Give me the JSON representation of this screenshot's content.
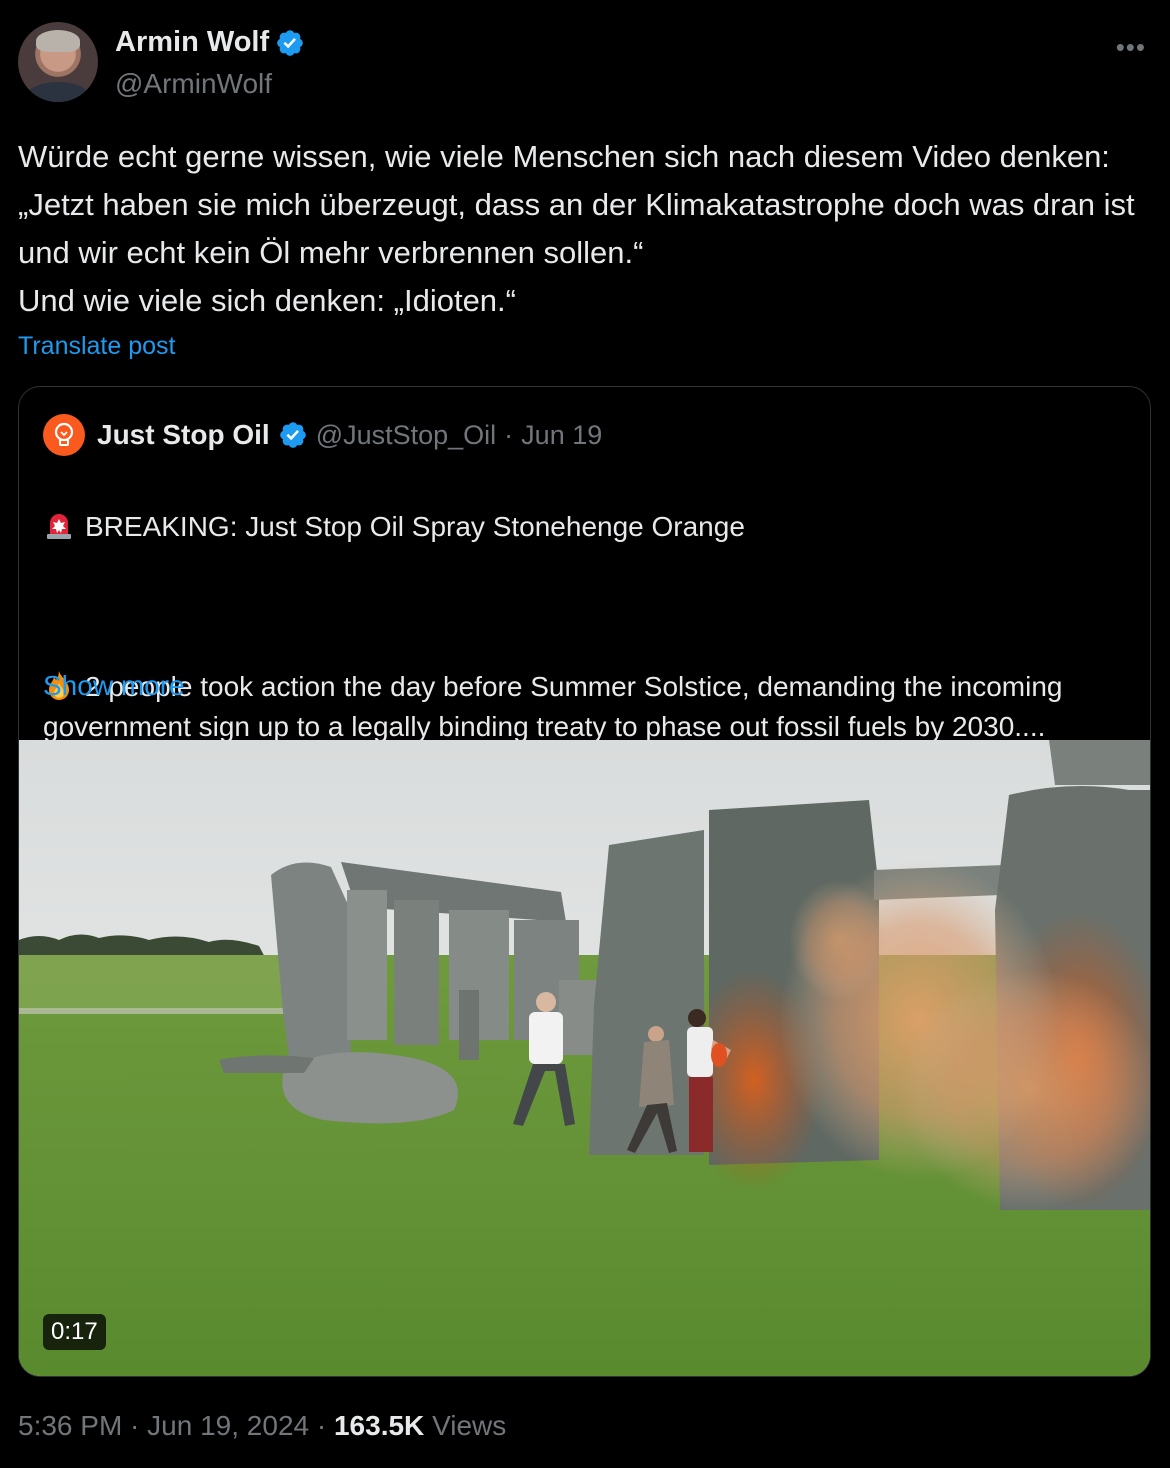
{
  "author": {
    "name": "Armin Wolf",
    "handle": "@ArminWolf",
    "verified_color": "#1d9bf0"
  },
  "post": {
    "text": "Würde echt gerne wissen, wie viele Menschen sich nach diesem Video denken: „Jetzt haben sie mich überzeugt, dass an der Klimakatastrophe doch was dran ist und wir echt kein Öl mehr verbrennen sollen.“\nUnd wie viele sich denken: „Idioten.“",
    "translate_label": "Translate post",
    "more_icon": "more-horizontal-icon"
  },
  "quote": {
    "name": "Just Stop Oil",
    "handle": "@JustStop_Oil",
    "separator": "·",
    "date": "Jun 19",
    "line1": "BREAKING: Just Stop Oil Spray Stonehenge Orange",
    "line2": "2 people took action the day before Summer Solstice, demanding the incoming government sign up to a legally binding treaty to phase out fossil fuels by 2030....",
    "show_more": "Show more",
    "emoji1": "siren-emoji",
    "emoji2": "fire-emoji",
    "video_duration": "0:17"
  },
  "footer": {
    "time": "5:36 PM",
    "sep1": " · ",
    "date": "Jun 19, 2024",
    "sep2": " · ",
    "views_count": "163.5K",
    "views_label": "Views"
  }
}
